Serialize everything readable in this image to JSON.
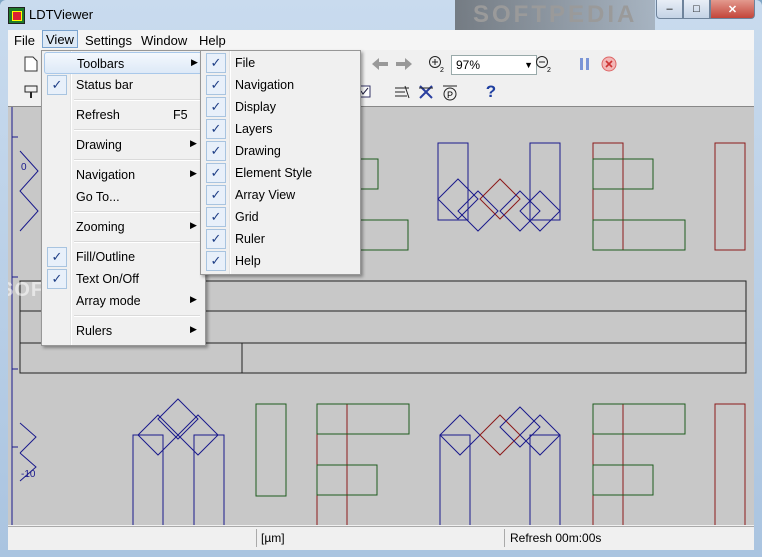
{
  "window": {
    "title": "LDTViewer",
    "watermark": "SOFTPEDIA",
    "minimize": "–",
    "maximize": "□",
    "close": "✕"
  },
  "menubar": {
    "items": [
      "File",
      "View",
      "Settings",
      "Window",
      "Help"
    ]
  },
  "zoom": {
    "value": "97%"
  },
  "view_menu": {
    "toolbars": "Toolbars",
    "status_bar": "Status bar",
    "refresh": "Refresh",
    "refresh_key": "F5",
    "drawing": "Drawing",
    "navigation": "Navigation",
    "goto": "Go To...",
    "zooming": "Zooming",
    "fill_outline": "Fill/Outline",
    "text_onoff": "Text On/Off",
    "array_mode": "Array mode",
    "rulers": "Rulers"
  },
  "toolbars_menu": {
    "items": [
      "File",
      "Navigation",
      "Display",
      "Layers",
      "Drawing",
      "Element Style",
      "Array View",
      "Grid",
      "Ruler",
      "Help"
    ]
  },
  "ruler": {
    "label_top": "0",
    "label_bottom": "-10"
  },
  "canvas_watermark": "SOFTPEDIA",
  "status": {
    "unit": "[µm]",
    "refresh": "Refresh 00m:00s"
  },
  "colors": {
    "blue": "#1a1a8c",
    "green": "#1e5c1e",
    "red": "#8c1a1a",
    "canvas": "#c8c8c8"
  }
}
